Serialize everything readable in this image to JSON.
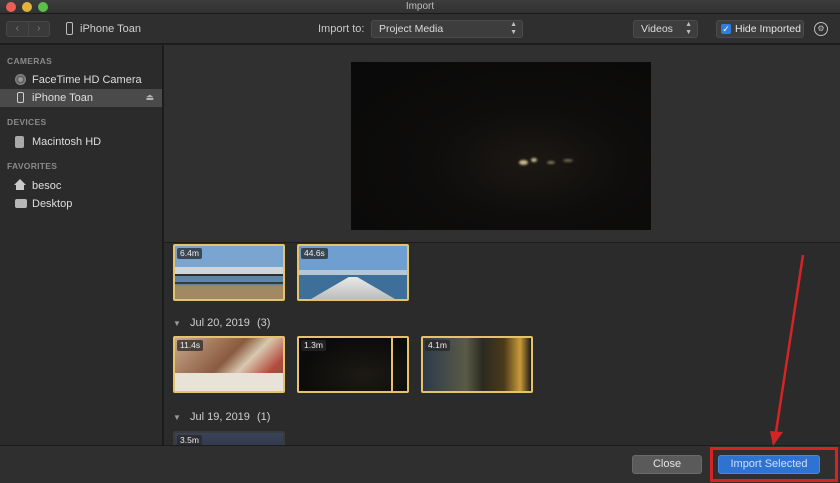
{
  "window": {
    "title": "Import"
  },
  "toolbar": {
    "device_name": "iPhone Toan",
    "import_to_label": "Import to:",
    "import_to_value": "Project Media",
    "filter_value": "Videos",
    "hide_imported_label": "Hide Imported",
    "hide_imported_checked": true
  },
  "sidebar": {
    "cameras_header": "CAMERAS",
    "cameras": [
      {
        "label": "FaceTime HD Camera",
        "icon": "camera-icon"
      },
      {
        "label": "iPhone Toan",
        "icon": "phone-icon",
        "selected": true
      }
    ],
    "devices_header": "DEVICES",
    "devices": [
      {
        "label": "Macintosh HD",
        "icon": "hard-drive-icon"
      }
    ],
    "favorites_header": "FAVORITES",
    "favorites": [
      {
        "label": "besoc",
        "icon": "home-icon"
      },
      {
        "label": "Desktop",
        "icon": "desktop-icon"
      }
    ]
  },
  "browser": {
    "group0": {
      "clips": [
        {
          "duration": "6.4m"
        },
        {
          "duration": "44.6s"
        }
      ]
    },
    "group1": {
      "date": "Jul 20, 2019",
      "count": "(3)",
      "clips": [
        {
          "duration": "11.4s"
        },
        {
          "duration": "1.3m"
        },
        {
          "duration": "4.1m"
        }
      ]
    },
    "group2": {
      "date": "Jul 19, 2019",
      "count": "(1)",
      "clips": [
        {
          "duration": "3.5m"
        }
      ]
    }
  },
  "buttons": {
    "close": "Close",
    "import_selected": "Import Selected"
  },
  "colors": {
    "accent": "#2e72d2",
    "selection_border": "#e5c36b",
    "annotation": "#d62323"
  }
}
